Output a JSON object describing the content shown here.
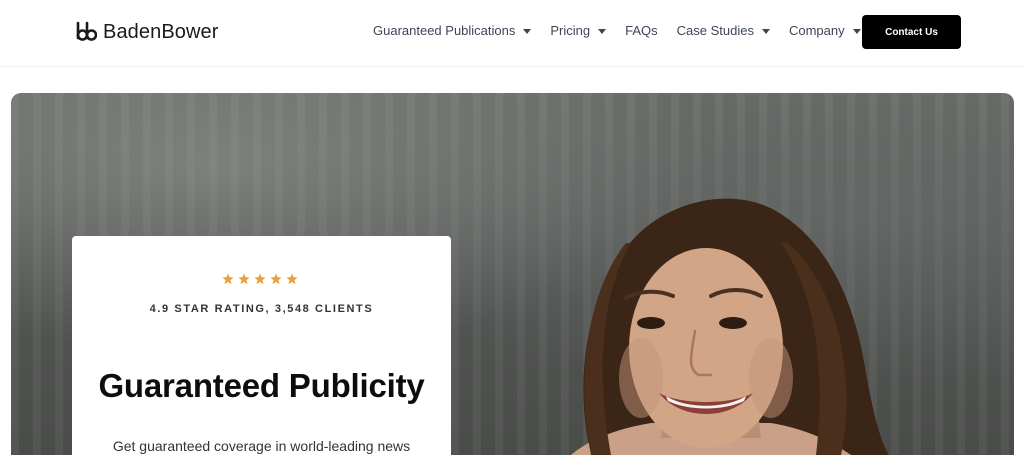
{
  "header": {
    "logo_text": "BadenBower",
    "nav": [
      {
        "label": "Guaranteed Publications",
        "has_dropdown": true
      },
      {
        "label": "Pricing",
        "has_dropdown": true
      },
      {
        "label": "FAQs",
        "has_dropdown": false
      },
      {
        "label": "Case Studies",
        "has_dropdown": true
      },
      {
        "label": "Company",
        "has_dropdown": true
      }
    ],
    "cta_label": "Contact Us"
  },
  "hero": {
    "stars_count": 5,
    "star_color": "#e8a33d",
    "rating_text": "4.9 STAR RATING, 3,548 CLIENTS",
    "headline": "Guaranteed Publicity",
    "subtext": "Get guaranteed coverage in world-leading news"
  },
  "colors": {
    "nav_text": "#3d4656",
    "cta_bg": "#000000",
    "cta_text": "#ffffff"
  }
}
